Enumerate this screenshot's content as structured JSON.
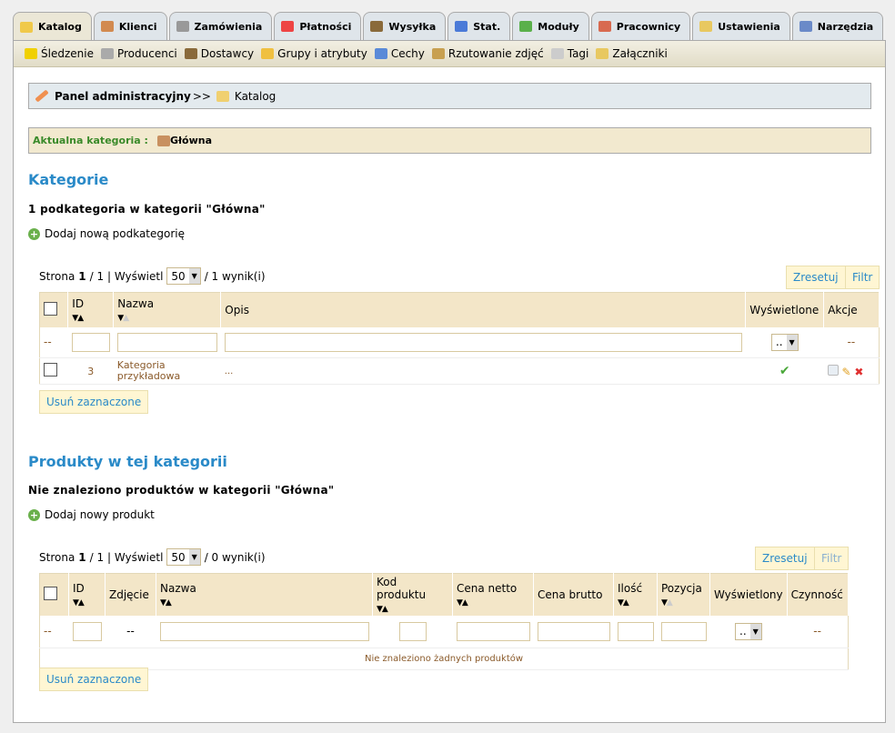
{
  "tabs": [
    {
      "label": "Katalog",
      "icon": "folder-icon",
      "color": "#f0c94a",
      "active": true
    },
    {
      "label": "Klienci",
      "icon": "user-icon",
      "color": "#d28a50"
    },
    {
      "label": "Zamówienia",
      "icon": "cart-icon",
      "color": "#999"
    },
    {
      "label": "Płatności",
      "icon": "payment-icon",
      "color": "#e44"
    },
    {
      "label": "Wysyłka",
      "icon": "truck-icon",
      "color": "#8a6a3a"
    },
    {
      "label": "Stat.",
      "icon": "chart-icon",
      "color": "#4a7ad8"
    },
    {
      "label": "Moduły",
      "icon": "puzzle-icon",
      "color": "#5ab04a"
    },
    {
      "label": "Pracownicy",
      "icon": "employee-icon",
      "color": "#d86a50"
    },
    {
      "label": "Ustawienia",
      "icon": "settings-icon",
      "color": "#e8c860"
    },
    {
      "label": "Narzędzia",
      "icon": "wrench-icon",
      "color": "#6a8ac8"
    }
  ],
  "subnav": [
    {
      "label": "Śledzenie",
      "icon": "warning-icon",
      "color": "#f0d000"
    },
    {
      "label": "Producenci",
      "icon": "gear-icon",
      "color": "#aaa"
    },
    {
      "label": "Dostawcy",
      "icon": "supplier-icon",
      "color": "#8a6a3a"
    },
    {
      "label": "Grupy i atrybuty",
      "icon": "star-icon",
      "color": "#f0c040"
    },
    {
      "label": "Cechy",
      "icon": "eye-icon",
      "color": "#5a8ad8"
    },
    {
      "label": "Rzutowanie zdjęć",
      "icon": "image-icon",
      "color": "#c8a050"
    },
    {
      "label": "Tagi",
      "icon": "cloud-icon",
      "color": "#ccc"
    },
    {
      "label": "Załączniki",
      "icon": "attachment-icon",
      "color": "#e8c860"
    }
  ],
  "breadcrumb": {
    "root": "Panel administracyjny",
    "sep": ">>",
    "current": "Katalog"
  },
  "current_category": {
    "label": "Aktualna kategoria :",
    "value": "Główna"
  },
  "categories": {
    "title": "Kategorie",
    "count_text": "1 podkategoria w kategorii \"Główna\"",
    "add_label": "Dodaj nową podkategorię",
    "pager": {
      "page_label": "Strona",
      "page": "1",
      "total": "/ 1 | Wyświetl",
      "per_page": "50",
      "results": "/ 1 wynik(i)"
    },
    "reset": "Zresetuj",
    "filter": "Filtr",
    "headers": [
      "ID",
      "Nazwa",
      "Opis",
      "Wyświetlone",
      "Akcje"
    ],
    "filter_select": "..",
    "dash": "--",
    "rows": [
      {
        "id": "3",
        "name": "Kategoria przykładowa",
        "desc": "...",
        "displayed": true
      }
    ],
    "delete_selected": "Usuń zaznaczone"
  },
  "products": {
    "title": "Produkty w tej kategorii",
    "count_text": "Nie znaleziono produktów w kategorii \"Główna\"",
    "add_label": "Dodaj nowy produkt",
    "pager": {
      "page_label": "Strona",
      "page": "1",
      "total": "/ 1 | Wyświetl",
      "per_page": "50",
      "results": "/ 0 wynik(i)"
    },
    "reset": "Zresetuj",
    "filter": "Filtr",
    "headers": [
      "ID",
      "Zdjęcie",
      "Nazwa",
      "Kod produktu",
      "Cena netto",
      "Cena brutto",
      "Ilość",
      "Pozycja",
      "Wyświetlony",
      "Czynność"
    ],
    "filter_select": "..",
    "dash": "--",
    "empty": "Nie znaleziono żadnych produktów",
    "delete_selected": "Usuń zaznaczone"
  }
}
